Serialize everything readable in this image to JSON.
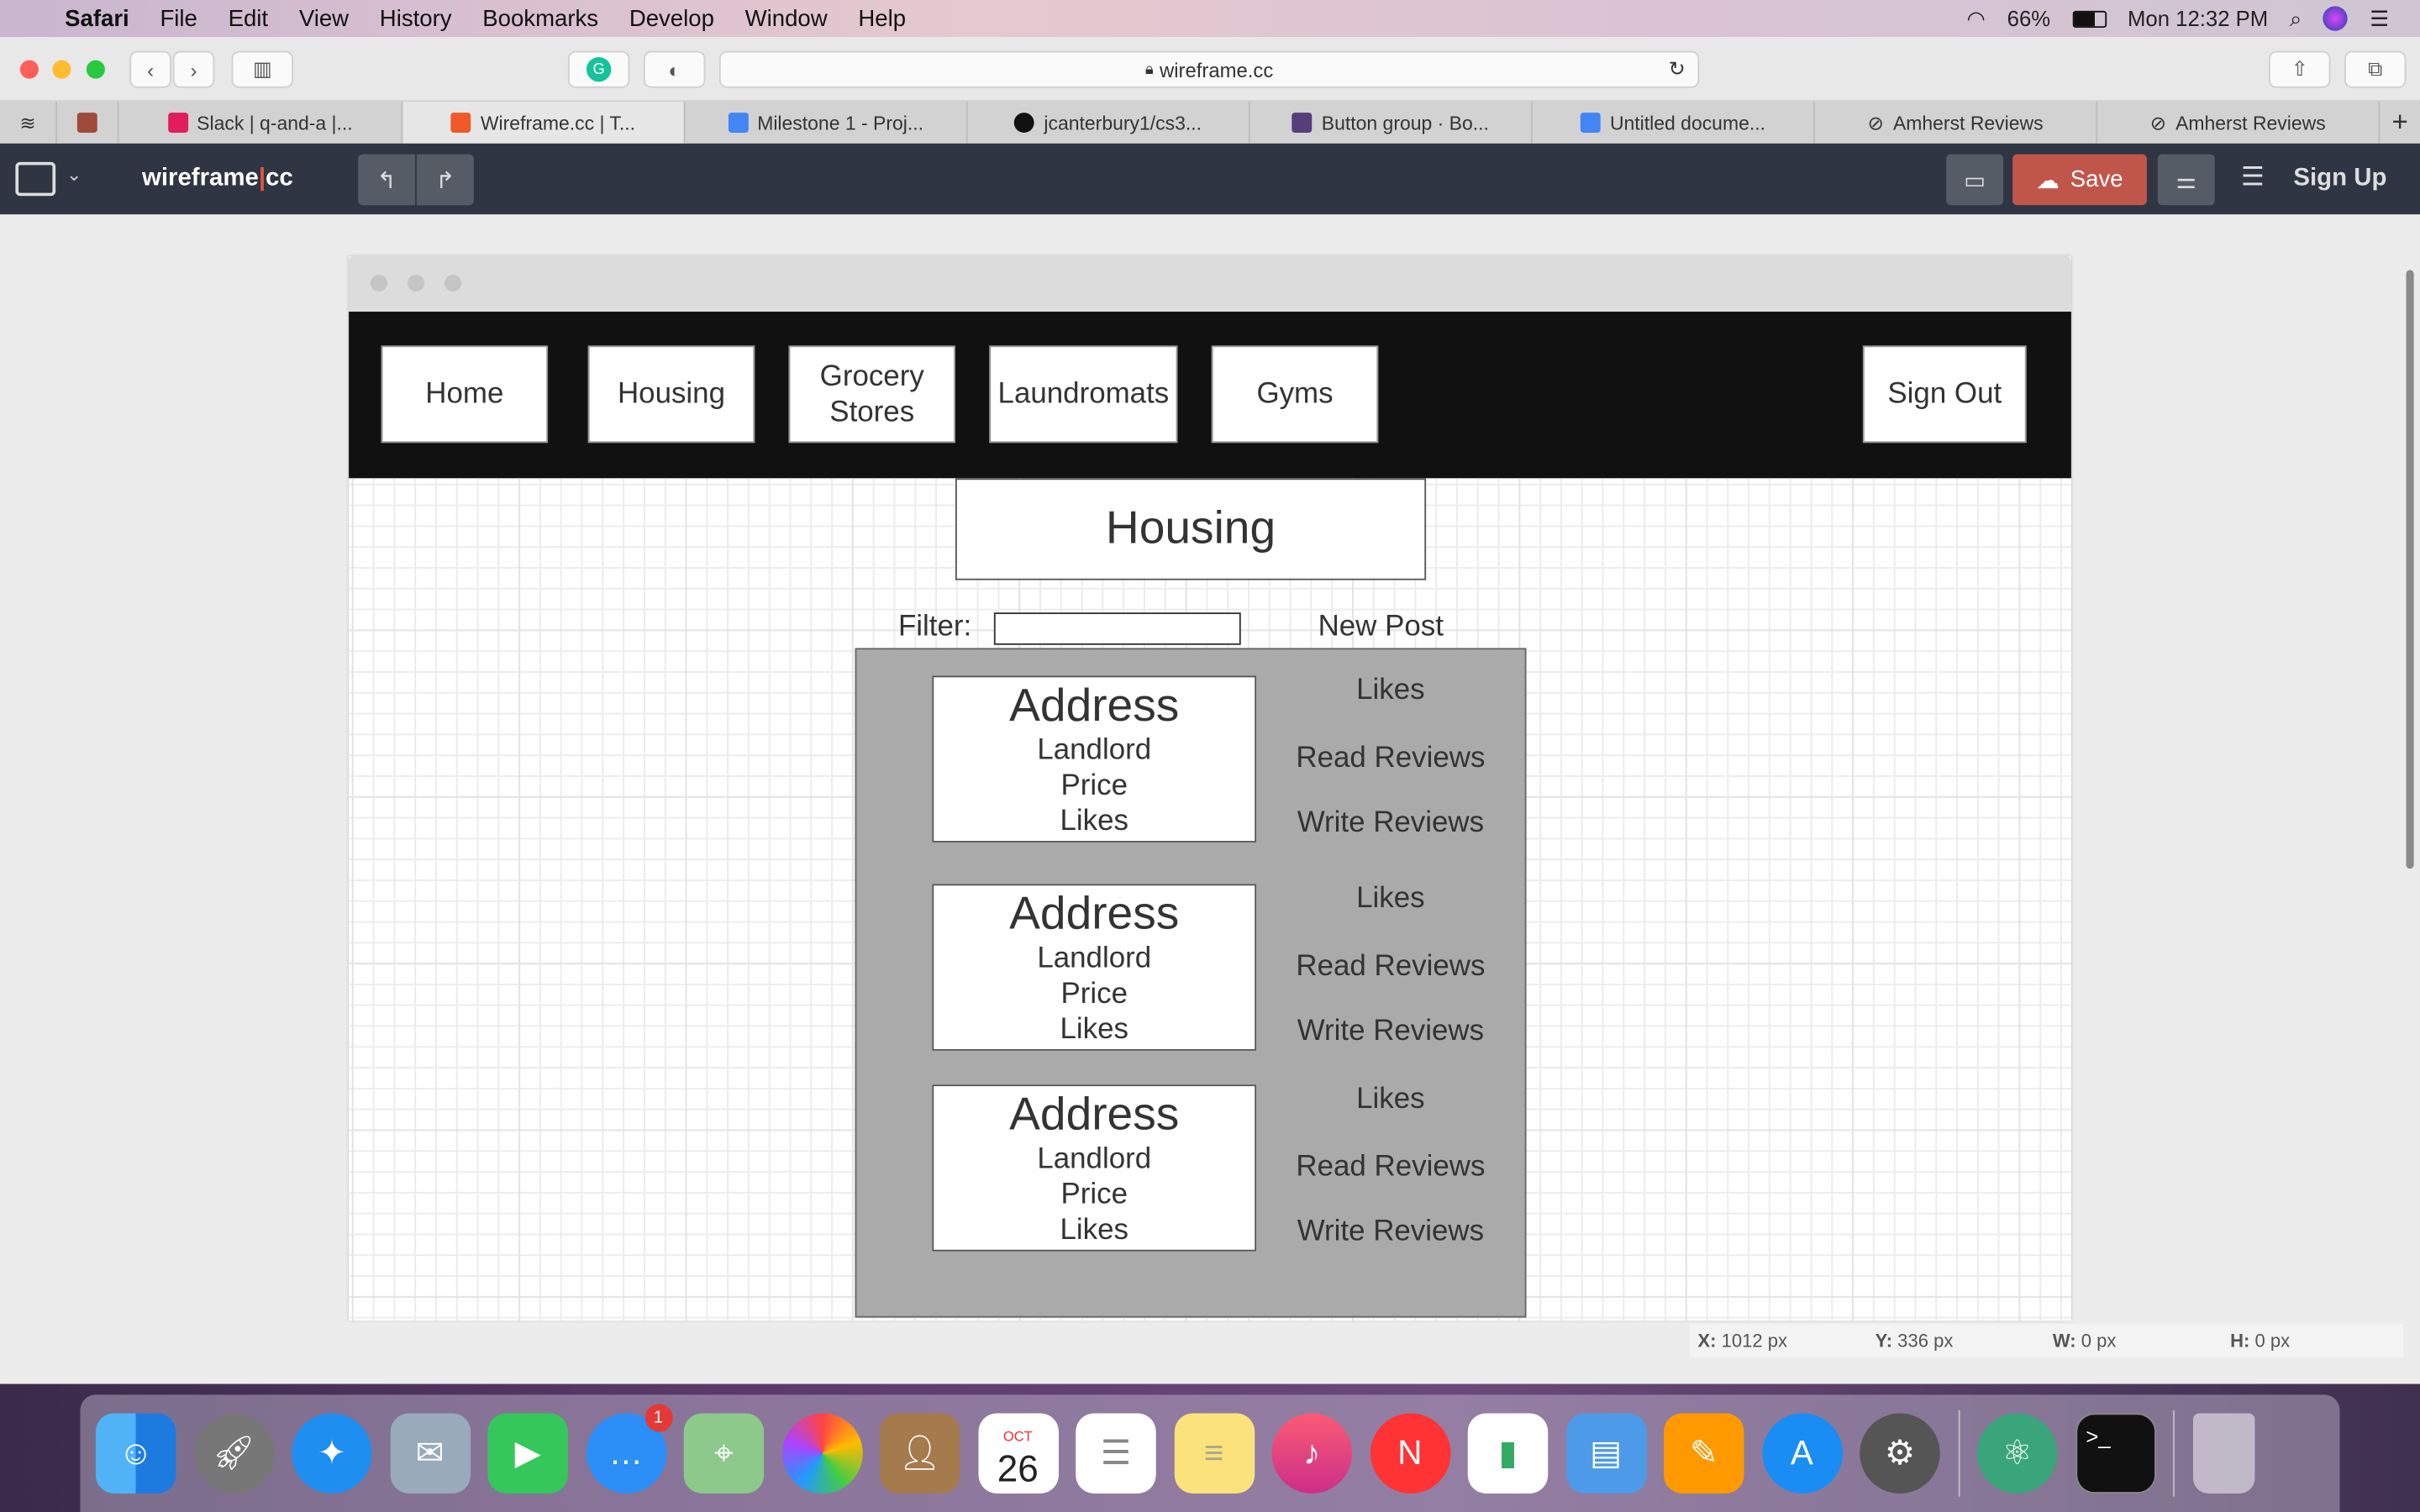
{
  "menubar": {
    "app": "Safari",
    "items": [
      "File",
      "Edit",
      "View",
      "History",
      "Bookmarks",
      "Develop",
      "Window",
      "Help"
    ],
    "battery": "66%",
    "clock": "Mon 12:32 PM"
  },
  "safari": {
    "url": "wireframe.cc"
  },
  "tabs": [
    {
      "label": "Slack | q-and-a |...",
      "color": "#e01e5a"
    },
    {
      "label": "Wireframe.cc | T...",
      "color": "#f05a28",
      "active": true
    },
    {
      "label": "Milestone 1 - Proj...",
      "color": "#4285f4"
    },
    {
      "label": "jcanterbury1/cs3...",
      "color": "#111111"
    },
    {
      "label": "Button group · Bo...",
      "color": "#563d7c"
    },
    {
      "label": "Untitled docume...",
      "color": "#4285f4"
    },
    {
      "label": "Amherst Reviews",
      "color": "#777777"
    },
    {
      "label": "Amherst Reviews",
      "color": "#777777"
    }
  ],
  "appbar": {
    "logo_left": "wireframe",
    "logo_right": "cc",
    "save": "Save",
    "signup": "Sign Up",
    "accent": "#c0564a"
  },
  "wireframe": {
    "nav": [
      "Home",
      "Housing",
      "Grocery Stores",
      "Laundromats",
      "Gyms"
    ],
    "signout": "Sign Out",
    "title": "Housing",
    "filter_label": "Filter:",
    "new_post": "New Post",
    "cards": [
      {
        "address": "Address",
        "landlord": "Landlord",
        "price": "Price",
        "likes": "Likes",
        "side_likes": "Likes",
        "read": "Read Reviews",
        "write": "Write Reviews"
      },
      {
        "address": "Address",
        "landlord": "Landlord",
        "price": "Price",
        "likes": "Likes",
        "side_likes": "Likes",
        "read": "Read Reviews",
        "write": "Write Reviews"
      },
      {
        "address": "Address",
        "landlord": "Landlord",
        "price": "Price",
        "likes": "Likes",
        "side_likes": "Likes",
        "read": "Read Reviews",
        "write": "Write Reviews"
      }
    ]
  },
  "status": {
    "x_label": "X:",
    "x": "1012 px",
    "y_label": "Y:",
    "y": "336 px",
    "w_label": "W:",
    "w": "0 px",
    "h_label": "H:",
    "h": "0 px"
  },
  "dock": {
    "messages_badge": "1",
    "calendar_month": "OCT",
    "calendar_day": "26"
  }
}
